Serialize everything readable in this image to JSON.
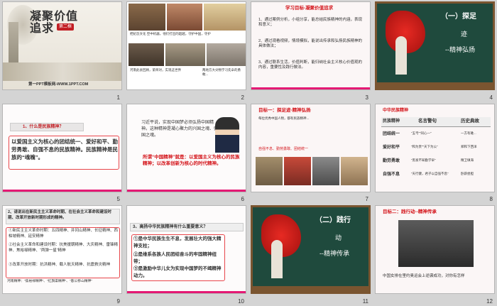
{
  "slides": [
    {
      "n": "1",
      "title": "凝聚价值追求",
      "tag": "第二框",
      "footer": "第一PPT模板网-WWW.1PPT.COM"
    },
    {
      "n": "2",
      "cap1": "把纪念文化 空中机器，他们打出的超越，守护中国，守护",
      "cap2": "河南此县回顾，第师对，实现这世界",
      "cap3": "两地方大尖物学习先辛的勇敢..."
    },
    {
      "n": "3",
      "heading": "学习目标-凝聚价值追求",
      "items": [
        "1、通过案例分析，小组分享，能总结民族精神的内涵，表现和意义；",
        "2、通过观看视频，情境模拟，能说出传承和弘扬民族精神的具体做法；",
        "3、通过联系生活，价值判断，能归纳社会主义核心价值观的内容，重要性及践行做法。"
      ]
    },
    {
      "n": "4",
      "h1": "（一）探足",
      "h2": "迹",
      "h3": "--精神弘扬"
    },
    {
      "n": "5",
      "q": "1、什么是民族精神？",
      "body": "以爱国主义为核心的团结统一、爱好和平、勤劳勇敢、自强不息的民族精神。民族精神是民族的“魂魄”。"
    },
    {
      "n": "6",
      "p1": "习近平说，实现中国梦必须弘扬中国精神。这种精神是凝心聚力的兴国之魂、强国之魂。",
      "p2": "所谓“中国精神”就是：以爱国主义为核心的民族精神；以改革创新为核心的时代精神。"
    },
    {
      "n": "7",
      "goal": "目标一：探足迹·精神弘扬",
      "note": "每位优秀中国人物，都有民族精神...",
      "bottom": "自强不息、勤劳勇敢、团结统一"
    },
    {
      "n": "8",
      "heading": "中华民族精神",
      "col1": "民族精神",
      "col2": "名言警句",
      "col3": "历史典故",
      "rows": [
        [
          "团结统一",
          "“五弓”“同心一”",
          "一方有难..."
        ],
        [
          "爱好和平",
          "“和为贵”“天下为公”",
          "郑和下西洋"
        ],
        [
          "勤劳勇敢",
          "“黑发不知勤学早”",
          "精卫填海"
        ],
        [
          "自强不息",
          "“天行健，君子以自强不息”",
          "卧薪尝胆"
        ]
      ]
    },
    {
      "n": "9",
      "q": "2、请说出在新民主主义革命时期、在社会主义革命和建设时期、改革开放新时期形成的精神。",
      "items": [
        "①新民主主义革命时期：五四精神、井冈山精神、长征精神、西柏坡精神、延安精神",
        "②社会主义革命和建设时期：抗美援朝精神、大庆精神、雷锋精神、焦裕禄精神、“两弹一星”精神",
        "③改革开放时期：抗洪精神、载人航天精神、抗震救灾精神"
      ],
      "footer": "河南精神：“焦裕禄精神”、“红旗渠精神”、“愚公移山精神”"
    },
    {
      "n": "10",
      "q": "3、高扬中华民族精神有什么重要意义？",
      "items": [
        "①是中华民族生生不息，发展壮大的强大精神支柱；",
        "②是维系各族人民团结奋斗的牢固精神纽带；",
        "③是激励中华儿女为实现中国梦的不竭精神动力。"
      ]
    },
    {
      "n": "11",
      "h1": "（二）践行",
      "h2": "动",
      "h3": "--精神传承"
    },
    {
      "n": "12",
      "goal": "目标二：践行动--精神传承",
      "caption": "中国女排在里约奥运会上逆袭成功，对你有怎样"
    }
  ]
}
